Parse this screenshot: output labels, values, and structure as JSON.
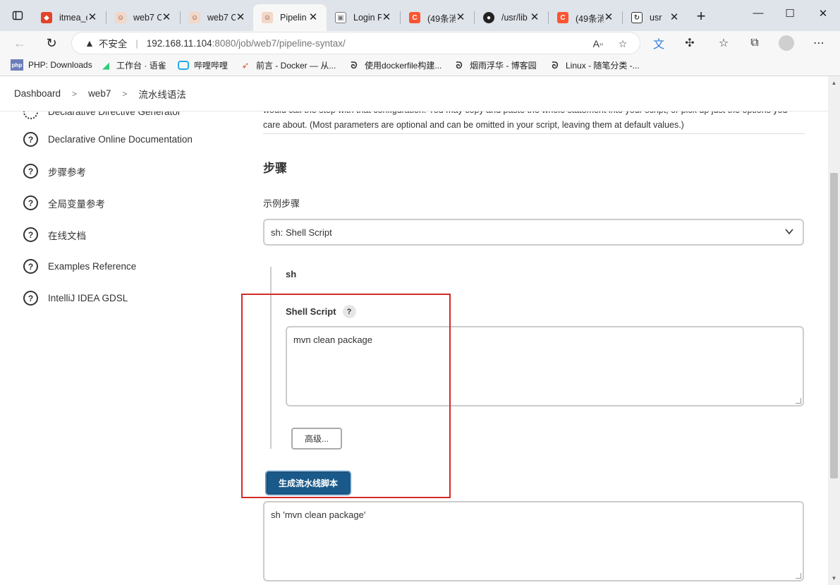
{
  "tabs": [
    {
      "label": "itmea_c",
      "icon": "gitlab-icon",
      "color": "#e24329"
    },
    {
      "label": "web7 C",
      "icon": "jenkins-icon",
      "color": "#d24939"
    },
    {
      "label": "web7 C",
      "icon": "jenkins-icon",
      "color": "#d24939"
    },
    {
      "label": "Pipelin",
      "icon": "jenkins-icon",
      "color": "#d24939",
      "active": true
    },
    {
      "label": "Login P",
      "icon": "image-icon",
      "color": "#777777"
    },
    {
      "label": "(49条消",
      "icon": "csdn-icon",
      "color": "#fc5531"
    },
    {
      "label": "/usr/lib",
      "icon": "github-icon",
      "color": "#222222"
    },
    {
      "label": "(49条消",
      "icon": "csdn-icon",
      "color": "#fc5531"
    },
    {
      "label": "usr",
      "icon": "page-icon",
      "color": "#333333"
    }
  ],
  "address": {
    "insecure_label": "不安全",
    "url_host": "192.168.11.104",
    "url_rest": ":8080/job/web7/pipeline-syntax/"
  },
  "bookmarks": [
    {
      "label": "PHP: Downloads",
      "icon": "php-icon"
    },
    {
      "label": "工作台 · 语雀",
      "icon": "yuque-icon"
    },
    {
      "label": "哔哩哔哩",
      "icon": "bilibili-icon"
    },
    {
      "label": "前言 - Docker — 从...",
      "icon": "rocket-icon"
    },
    {
      "label": "使用dockerfile构建...",
      "icon": "cnblogs-icon"
    },
    {
      "label": "烟雨浮华 - 博客园",
      "icon": "cnblogs-icon"
    },
    {
      "label": "Linux - 随笔分类 -...",
      "icon": "cnblogs-icon"
    }
  ],
  "breadcrumb": [
    "Dashboard",
    "web7",
    "流水线语法"
  ],
  "sidebar": {
    "partial_item": "Declarative Directive Generator",
    "items": [
      "Declarative Online Documentation",
      "步骤参考",
      "全局变量参考",
      "在线文档",
      "Examples Reference",
      "IntelliJ IDEA GDSL"
    ]
  },
  "main": {
    "description": "would call the step with that configuration. You may copy and paste the whole statement into your script, or pick up just the options you care about. (Most parameters are optional and can be omitted in your script, leaving them at default values.)",
    "section_title": "步骤",
    "sample_step_label": "示例步骤",
    "sample_step_value": "sh: Shell Script",
    "step_name": "sh",
    "shell_script_label": "Shell Script",
    "help_label": "?",
    "shell_script_value": "mvn clean package",
    "advanced_button": "高级...",
    "generate_button": "生成流水线脚本",
    "generated_script": "sh 'mvn clean package'"
  }
}
